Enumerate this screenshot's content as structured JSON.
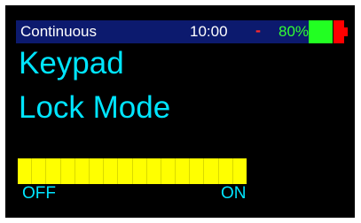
{
  "status_bar": {
    "mode": "Continuous",
    "time": "10:00",
    "sign": "-",
    "battery_percent": "80%",
    "battery_level": 0.7,
    "colors": {
      "background": "#0c1a6e",
      "battery_text": "#32ff32",
      "battery_fill": "#22ff22",
      "battery_empty": "#ff0000",
      "sign": "#ff2a2a"
    }
  },
  "title": {
    "line1": "Keypad",
    "line2": "Lock Mode",
    "color": "#00e5ff"
  },
  "toggle": {
    "off_label": "OFF",
    "on_label": "ON",
    "value": "OFF",
    "segment_count": 16,
    "fill_color": "#ffff00"
  }
}
